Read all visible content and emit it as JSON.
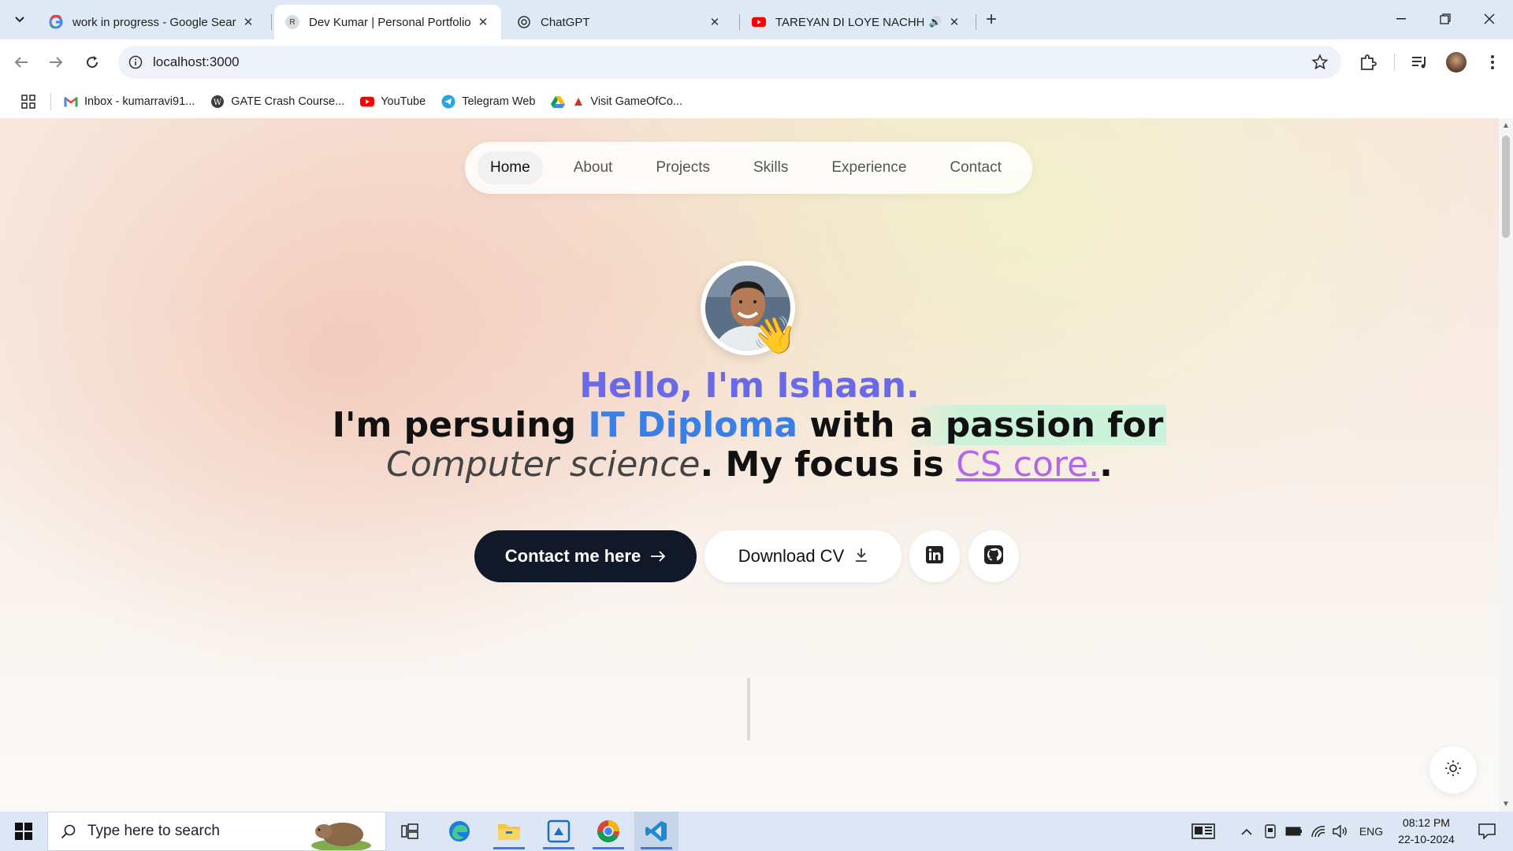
{
  "browser": {
    "tabs": [
      {
        "title": "work in progress - Google Sear",
        "favicon": "google-icon",
        "active": false
      },
      {
        "title": "Dev Kumar | Personal Portfolio",
        "favicon": "letter-r-icon",
        "favicon_letter": "R",
        "active": true
      },
      {
        "title": "ChatGPT",
        "favicon": "chatgpt-icon",
        "active": false
      },
      {
        "title": "TAREYAN DI LOYE NACHHA",
        "favicon": "youtube-icon",
        "active": false,
        "audio": true
      }
    ],
    "url": "localhost:3000",
    "bookmarks": [
      {
        "label": "Inbox - kumarravi91...",
        "icon": "gmail-icon"
      },
      {
        "label": "GATE Crash Course...",
        "icon": "wordpress-icon"
      },
      {
        "label": "YouTube",
        "icon": "youtube-icon"
      },
      {
        "label": "Telegram Web",
        "icon": "telegram-icon"
      },
      {
        "label": "Visit GameOfCo...",
        "icon": "drive-icon"
      }
    ]
  },
  "site": {
    "nav": [
      "Home",
      "About",
      "Projects",
      "Skills",
      "Experience",
      "Contact"
    ],
    "active_nav": "Home",
    "hero": {
      "hello": "Hello, I'm Ishaan.",
      "line2_a": "I'm persuing ",
      "line2_b": "IT Diploma",
      "line2_c": " with ",
      "line2_d": "a passion for",
      "line3_a": "Computer science",
      "line3_b": ". My focus is ",
      "line3_c": "CS core.",
      "line3_d": "."
    },
    "contact_button": "Contact me here",
    "cv_button": "Download CV",
    "wave_emoji": "👋",
    "colors": {
      "hello": "#6a6ae8",
      "accent_blue": "#3a7fe6",
      "accent_purple": "#b266e8",
      "dark_button": "#111827"
    }
  },
  "taskbar": {
    "search_placeholder": "Type here to search",
    "language": "ENG",
    "time": "08:12 PM",
    "date": "22-10-2024"
  }
}
